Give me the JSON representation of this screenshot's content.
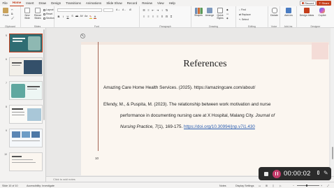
{
  "menu": {
    "items": [
      "File",
      "Home",
      "Insert",
      "Draw",
      "Design",
      "Transitions",
      "Animations",
      "Slide Show",
      "Record",
      "Review",
      "View",
      "Help"
    ],
    "active": "Home",
    "record_label": "Record",
    "share_label": "Share"
  },
  "ribbon": {
    "groups": {
      "clipboard": "Clipboard",
      "slides": "Slides",
      "font": "Font",
      "paragraph": "Paragraph",
      "drawing": "Drawing",
      "editing": "Editing",
      "voice": "Voice",
      "addins": "Add-ins",
      "designer": "Designer"
    },
    "paste_label": "Paste",
    "new_slide_label": "New Slide",
    "reuse_slides_label": "Reuse Slides",
    "layout_label": "Layout",
    "reset_label": "Reset",
    "section_label": "Section",
    "shapes_label": "Shapes",
    "arrange_label": "Arrange",
    "quick_styles_label": "Quick Styles",
    "find_label": "Find",
    "replace_label": "Replace",
    "select_label": "Select",
    "dictate_label": "Dictate",
    "addins_label": "Add-ins",
    "design_ideas_label": "Design Ideas",
    "copilot_label": "Copilot"
  },
  "thumbnails": [
    {
      "num": "5",
      "selected": true
    },
    {
      "num": "6",
      "selected": false
    },
    {
      "num": "7",
      "selected": false
    },
    {
      "num": "8",
      "selected": false
    },
    {
      "num": "9",
      "selected": false
    },
    {
      "num": "10",
      "selected": false
    }
  ],
  "slide": {
    "title": "References",
    "ref1": "Amazing Care Home Health Services. (2025). https://amazingcare.com/about/",
    "ref2_line1": "Efendy, M., & Puspita, M. (2023). The relationship between work motivation and nurse",
    "ref2_line2_a": "performance in documenting nursing care at X Hospital, Malang City. ",
    "ref2_line2_b": "Journal of",
    "ref2_line3_a": "Nursing Practice, 7",
    "ref2_line3_b": "(1), 169-175. ",
    "ref2_line3_link": "https://doi.org/10.30994/jnp.v7i1.430",
    "number": "10"
  },
  "notes_placeholder": "Click to add notes",
  "status": {
    "slide_count": "Slide 10 of 10",
    "accessibility": "Accessibility: Investigate",
    "notes": "Notes",
    "display_settings": "Display Settings"
  },
  "recording": {
    "time": "00:00:02"
  },
  "colors": {
    "accent": "#c43e1c",
    "slide_bg": "#fbf6f0",
    "rec_pause": "#c33a6a"
  }
}
